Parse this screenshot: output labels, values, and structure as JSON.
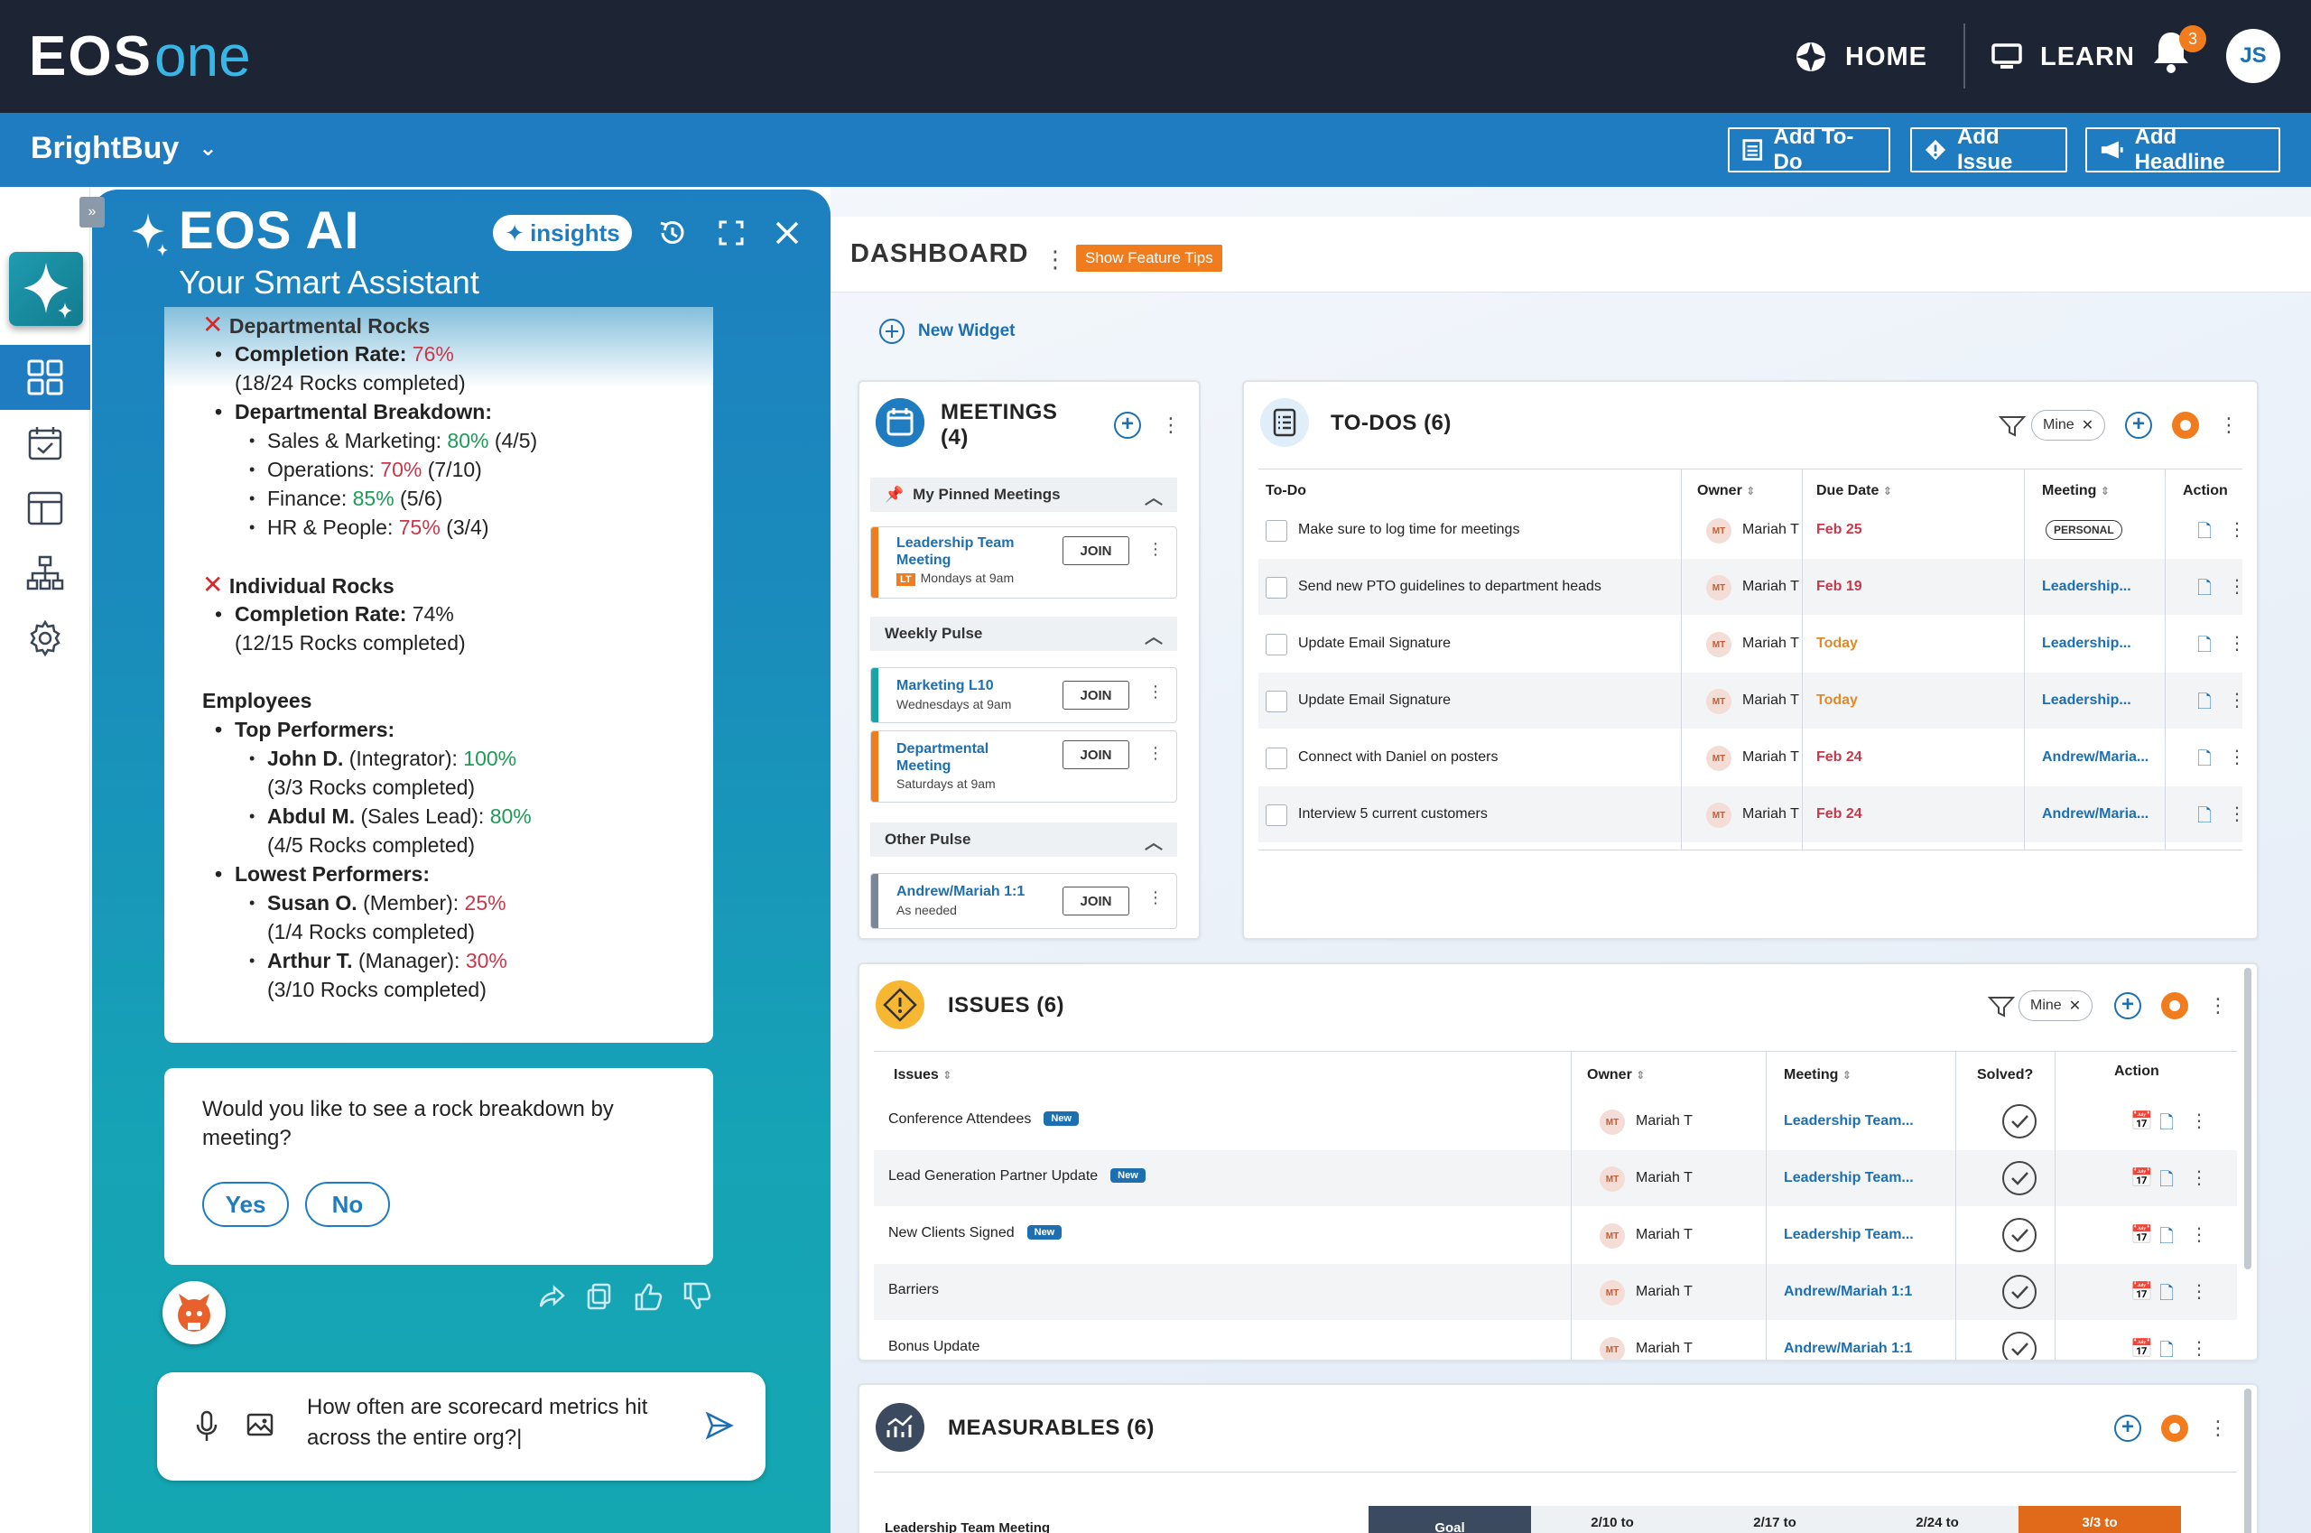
{
  "topbar": {
    "logo_left": "EOS",
    "logo_right": "one",
    "home_label": "HOME",
    "learn_label": "LEARN",
    "notification_count": "3",
    "avatar_initials": "JS"
  },
  "orgbar": {
    "org_name": "BrightBuy",
    "add_todo": "Add To-Do",
    "add_issue": "Add Issue",
    "add_headline": "Add Headline"
  },
  "ai": {
    "collapse_glyph": "»",
    "title": "EOS AI",
    "subtitle": "Your Smart Assistant",
    "insights_label": "insights",
    "message": {
      "dept_rocks": "Departmental Rocks",
      "completion_rate_label": "Completion Rate:",
      "completion_rate_value": "76%",
      "completion_rate_detail": "(18/24 Rocks completed)",
      "dept_breakdown": "Departmental Breakdown:",
      "depts": [
        {
          "name": "Sales & Marketing:",
          "pct": "80%",
          "detail": "(4/5)",
          "color": "green"
        },
        {
          "name": "Operations:",
          "pct": "70%",
          "detail": "(7/10)",
          "color": "red"
        },
        {
          "name": "Finance:",
          "pct": "85%",
          "detail": "(5/6)",
          "color": "green"
        },
        {
          "name": "HR & People:",
          "pct": "75%",
          "detail": "(3/4)",
          "color": "red"
        }
      ],
      "indiv_rocks": "Individual Rocks",
      "indiv_rate_label": "Completion Rate:",
      "indiv_rate_value": "74%",
      "indiv_detail": "(12/15 Rocks completed)",
      "employees": "Employees",
      "top_performers": "Top Performers:",
      "lowest_performers": "Lowest Performers:",
      "top": [
        {
          "name": "John D.",
          "role": "(Integrator):",
          "pct": "100%",
          "detail": "(3/3 Rocks completed)"
        },
        {
          "name": "Abdul M.",
          "role": "(Sales Lead):",
          "pct": "80%",
          "detail": "(4/5 Rocks completed)"
        }
      ],
      "low": [
        {
          "name": "Susan O.",
          "role": "(Member):",
          "pct": "25%",
          "detail": "(1/4 Rocks completed)"
        },
        {
          "name": "Arthur T.",
          "role": "(Manager):",
          "pct": "30%",
          "detail": "(3/10 Rocks completed)"
        }
      ]
    },
    "question": "Would you like to see a rock breakdown by meeting?",
    "yes_label": "Yes",
    "no_label": "No",
    "input_text": "How often are scorecard metrics hit across the entire org?|"
  },
  "dashboard": {
    "title": "DASHBOARD",
    "tips_label": "Show Feature Tips",
    "new_widget_label": "New Widget"
  },
  "meetings": {
    "title_line1": "MEETINGS",
    "title_line2": "(4)",
    "pinned_header": "My Pinned Meetings",
    "weekly_header": "Weekly Pulse",
    "other_header": "Other Pulse",
    "join_label": "JOIN",
    "lt_badge": "LT",
    "items": [
      {
        "name": "Leadership Team Meeting",
        "when": "Mondays at 9am"
      },
      {
        "name": "Marketing L10",
        "when": "Wednesdays at 9am"
      },
      {
        "name": "Departmental Meeting",
        "when": "Saturdays at 9am"
      },
      {
        "name": "Andrew/Mariah 1:1",
        "when": "As needed"
      }
    ]
  },
  "todos": {
    "title": "TO-DOS (6)",
    "mine_label": "Mine",
    "columns": [
      "To-Do",
      "Owner",
      "Due Date",
      "Meeting",
      "Action"
    ],
    "personal_label": "PERSONAL",
    "owner_initials": "MT",
    "rows": [
      {
        "todo": "Make sure to log time for meetings",
        "owner": "Mariah T",
        "due": "Feb 25",
        "meeting": ""
      },
      {
        "todo": "Send new PTO guidelines to department heads",
        "owner": "Mariah T",
        "due": "Feb 19",
        "meeting": "Leadership..."
      },
      {
        "todo": "Update Email Signature",
        "owner": "Mariah T",
        "due": "Today",
        "meeting": "Leadership..."
      },
      {
        "todo": "Update Email Signature",
        "owner": "Mariah T",
        "due": "Today",
        "meeting": "Leadership..."
      },
      {
        "todo": "Connect with Daniel on posters",
        "owner": "Mariah T",
        "due": "Feb 24",
        "meeting": "Andrew/Maria..."
      },
      {
        "todo": "Interview 5 current customers",
        "owner": "Mariah T",
        "due": "Feb 24",
        "meeting": "Andrew/Maria..."
      }
    ]
  },
  "issues": {
    "title": "ISSUES (6)",
    "mine_label": "Mine",
    "columns": [
      "Issues",
      "Owner",
      "Meeting",
      "Solved?",
      "Action"
    ],
    "new_label": "New",
    "owner_initials": "MT",
    "rows": [
      {
        "issue": "Conference Attendees",
        "new": true,
        "owner": "Mariah T",
        "meeting": "Leadership Team..."
      },
      {
        "issue": "Lead Generation Partner Update",
        "new": true,
        "owner": "Mariah T",
        "meeting": "Leadership Team..."
      },
      {
        "issue": "New Clients Signed",
        "new": true,
        "owner": "Mariah T",
        "meeting": "Leadership Team..."
      },
      {
        "issue": "Barriers",
        "new": false,
        "owner": "Mariah T",
        "meeting": "Andrew/Mariah 1:1"
      },
      {
        "issue": "Bonus Update",
        "new": false,
        "owner": "Mariah T",
        "meeting": "Andrew/Mariah 1:1"
      }
    ]
  },
  "measurables": {
    "title": "MEASURABLES (6)",
    "row_label": "Leadership Team Meeting",
    "goal_label": "Goal",
    "weeks": [
      "2/10 to",
      "2/17 to",
      "2/24 to",
      "3/3 to"
    ]
  },
  "colors": {
    "topbar": "#1d2433",
    "orgbar": "#1f7cc0",
    "accent": "#f07c1e",
    "link": "#1e6fb0"
  }
}
